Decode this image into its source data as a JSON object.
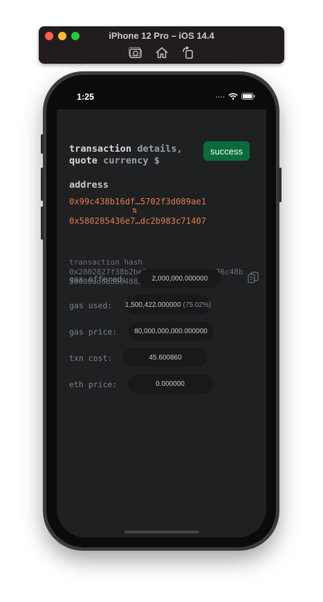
{
  "simulator": {
    "title": "iPhone 12 Pro – iOS 14.4",
    "toolbar": [
      {
        "icon": "camera-icon"
      },
      {
        "icon": "home-icon"
      },
      {
        "icon": "rotate-icon"
      }
    ]
  },
  "status_bar": {
    "time": "1:25"
  },
  "header": {
    "title_word1": "transaction",
    "title_word2": "details,",
    "title_word3": "quote",
    "title_word4": "currency $",
    "status_label": "success"
  },
  "address": {
    "label": "address",
    "from": "0x99c438b16df…5702f3d089ae1",
    "swap_glyph": "⇅",
    "to": "0x580285436e7…dc2b983c71407"
  },
  "hash": {
    "label": "transaction hash",
    "value": "0x2802827f38b2be37cd96b3b233d68336c48b5b680ad6bb604885553729b38f8a"
  },
  "rows": [
    {
      "label": "gas offered:",
      "value": "2,000,000.000000",
      "extra": ""
    },
    {
      "label": "gas used:",
      "value": "1,500,422.000000",
      "extra": "(75.02%)"
    },
    {
      "label": "gas price:",
      "value": "80,000,000,000.000000",
      "extra": ""
    },
    {
      "label": "txn cost:",
      "value": "45.600860",
      "extra": ""
    },
    {
      "label": "eth price:",
      "value": "0.000000",
      "extra": ""
    }
  ],
  "colors": {
    "accent_orange": "#e27b4f",
    "success_green": "#0c6b3c",
    "background": "#1e2022"
  }
}
